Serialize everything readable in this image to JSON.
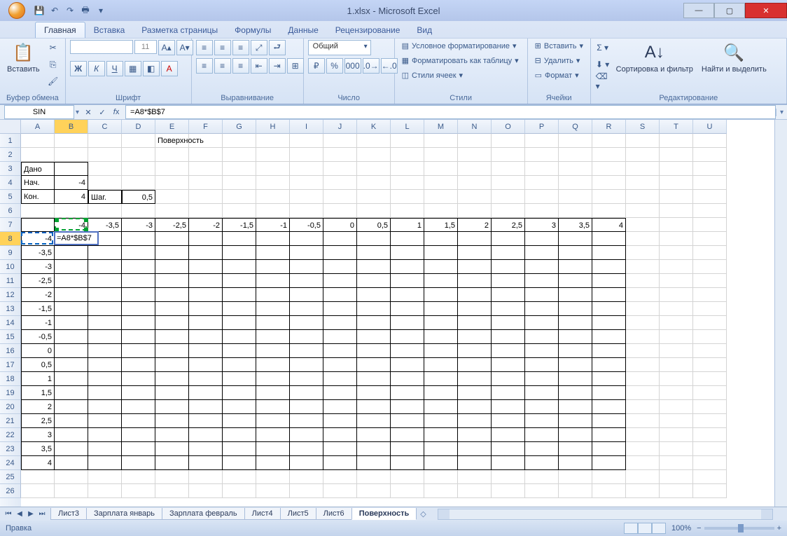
{
  "title": "1.xlsx - Microsoft Excel",
  "qat": {
    "save": "💾",
    "undo": "↶",
    "redo": "↷",
    "print": "🖶"
  },
  "tabs": [
    "Главная",
    "Вставка",
    "Разметка страницы",
    "Формулы",
    "Данные",
    "Рецензирование",
    "Вид"
  ],
  "activeTab": 0,
  "groups": {
    "clipboard": {
      "label": "Буфер обмена",
      "paste": "Вставить"
    },
    "font": {
      "label": "Шрифт",
      "name": "",
      "size": "11",
      "bold": "Ж",
      "italic": "К",
      "underline": "Ч"
    },
    "align": {
      "label": "Выравнивание"
    },
    "number": {
      "label": "Число",
      "format": "Общий"
    },
    "styles": {
      "label": "Стили",
      "cond": "Условное форматирование",
      "table": "Форматировать как таблицу",
      "cell": "Стили ячеек"
    },
    "cells": {
      "label": "Ячейки",
      "insert": "Вставить",
      "delete": "Удалить",
      "format": "Формат"
    },
    "editing": {
      "label": "Редактирование",
      "sort": "Сортировка и фильтр",
      "find": "Найти и выделить"
    }
  },
  "nameBox": "SIN",
  "formula": "=A8*$B$7",
  "columns": [
    "A",
    "B",
    "C",
    "D",
    "E",
    "F",
    "G",
    "H",
    "I",
    "J",
    "K",
    "L",
    "M",
    "N",
    "O",
    "P",
    "Q",
    "R",
    "S",
    "T",
    "U"
  ],
  "rows": 26,
  "activeRow": 8,
  "activeCol": "B",
  "cellData": {
    "1": {
      "E": {
        "v": "Поверхность",
        "align": "center",
        "span": true
      }
    },
    "3": {
      "A": {
        "v": "Дано",
        "align": "left",
        "b": true
      }
    },
    "4": {
      "A": {
        "v": "Нач.",
        "align": "left",
        "b": true
      },
      "B": {
        "v": "-4",
        "b": true
      }
    },
    "5": {
      "A": {
        "v": "Кон.",
        "align": "left",
        "b": true
      },
      "B": {
        "v": "4",
        "b": true
      },
      "C": {
        "v": "Шаг.",
        "align": "left",
        "b": true
      },
      "D": {
        "v": "0,5",
        "b": true
      }
    },
    "7": {
      "B": {
        "v": "-4"
      },
      "C": {
        "v": "-3,5"
      },
      "D": {
        "v": "-3"
      },
      "E": {
        "v": "-2,5"
      },
      "F": {
        "v": "-2"
      },
      "G": {
        "v": "-1,5"
      },
      "H": {
        "v": "-1"
      },
      "I": {
        "v": "-0,5"
      },
      "J": {
        "v": "0"
      },
      "K": {
        "v": "0,5"
      },
      "L": {
        "v": "1"
      },
      "M": {
        "v": "1,5"
      },
      "N": {
        "v": "2"
      },
      "O": {
        "v": "2,5"
      },
      "P": {
        "v": "3"
      },
      "Q": {
        "v": "3,5"
      },
      "R": {
        "v": "4"
      }
    },
    "8": {
      "A": {
        "v": "-4"
      }
    },
    "9": {
      "A": {
        "v": "-3,5"
      }
    },
    "10": {
      "A": {
        "v": "-3"
      }
    },
    "11": {
      "A": {
        "v": "-2,5"
      }
    },
    "12": {
      "A": {
        "v": "-2"
      }
    },
    "13": {
      "A": {
        "v": "-1,5"
      }
    },
    "14": {
      "A": {
        "v": "-1"
      }
    },
    "15": {
      "A": {
        "v": "-0,5"
      }
    },
    "16": {
      "A": {
        "v": "0"
      }
    },
    "17": {
      "A": {
        "v": "0,5"
      }
    },
    "18": {
      "A": {
        "v": "1"
      }
    },
    "19": {
      "A": {
        "v": "1,5"
      }
    },
    "20": {
      "A": {
        "v": "2"
      }
    },
    "21": {
      "A": {
        "v": "2,5"
      }
    },
    "22": {
      "A": {
        "v": "3"
      }
    },
    "23": {
      "A": {
        "v": "3,5"
      }
    },
    "24": {
      "A": {
        "v": "4"
      }
    }
  },
  "tableRange": {
    "rowStart": 7,
    "rowEnd": 24,
    "colStart": "A",
    "colEnd": "R"
  },
  "editCell": {
    "row": 8,
    "col": "B",
    "text": "=A8*$B$7"
  },
  "refA8": {
    "row": 8,
    "col": "A"
  },
  "refB7": {
    "row": 7,
    "col": "B"
  },
  "sheetTabs": [
    "Лист3",
    "Зарплата январь",
    "Зарплата февраль",
    "Лист4",
    "Лист5",
    "Лист6",
    "Поверхность"
  ],
  "activeSheet": 6,
  "status": "Правка",
  "zoom": "100%"
}
